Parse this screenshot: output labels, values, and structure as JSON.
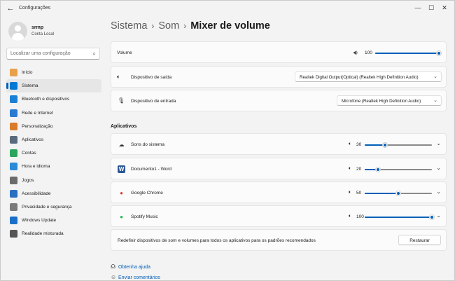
{
  "titlebar": {
    "back": "←",
    "title": "Configurações",
    "minimize": "—",
    "maximize": "☐",
    "close": "✕"
  },
  "profile": {
    "name": "srmp",
    "subtitle": "Conta Local"
  },
  "search": {
    "placeholder": "Localizar uma configuração",
    "icon": "⌕"
  },
  "nav": [
    {
      "label": "Início",
      "icon": "home-icon",
      "color": "#e8a04b"
    },
    {
      "label": "Sistema",
      "icon": "system-icon",
      "color": "#0078d4",
      "active": true
    },
    {
      "label": "Bluetooth e dispositivos",
      "icon": "bluetooth-icon",
      "color": "#1b7fd6"
    },
    {
      "label": "Rede e Internet",
      "icon": "network-icon",
      "color": "#2a7ad2"
    },
    {
      "label": "Personalização",
      "icon": "brush-icon",
      "color": "#d97b2b"
    },
    {
      "label": "Aplicativos",
      "icon": "apps-icon",
      "color": "#5a6b7d"
    },
    {
      "label": "Contas",
      "icon": "accounts-icon",
      "color": "#2ba55b"
    },
    {
      "label": "Hora e idioma",
      "icon": "time-language-icon",
      "color": "#2a8ad8"
    },
    {
      "label": "Jogos",
      "icon": "gaming-icon",
      "color": "#6b6b6b"
    },
    {
      "label": "Acessibilidade",
      "icon": "accessibility-icon",
      "color": "#2a6fc2"
    },
    {
      "label": "Privacidade e segurança",
      "icon": "shield-icon",
      "color": "#7a7a7a"
    },
    {
      "label": "Windows Update",
      "icon": "windows-update-icon",
      "color": "#1b6fc8"
    },
    {
      "label": "Realidade misturada",
      "icon": "mixed-reality-icon",
      "color": "#555555"
    }
  ],
  "breadcrumb": {
    "items": [
      "Sistema",
      "Som"
    ],
    "separator": "›",
    "current": "Mixer de volume"
  },
  "master": {
    "label": "Volume",
    "value": "100",
    "level": 1.0
  },
  "output": {
    "label": "Dispositivo de saída",
    "selected": "Realtek Digital Output(Optical) (Realtek High Definition Audio)"
  },
  "input": {
    "label": "Dispositivo de entrada",
    "selected": "Microfone (Realtek High Definition Audio)"
  },
  "apps_section": {
    "title": "Aplicativos"
  },
  "apps": [
    {
      "name": "Sons do sistema",
      "icon": "system-sounds-icon",
      "value": "30",
      "level": 0.3
    },
    {
      "name": "Documento1 - Word",
      "icon": "word-icon",
      "value": "20",
      "level": 0.2
    },
    {
      "name": "Google Chrome",
      "icon": "chrome-icon",
      "value": "50",
      "level": 0.5
    },
    {
      "name": "Spotify Music",
      "icon": "spotify-icon",
      "value": "100",
      "level": 1.0
    }
  ],
  "reset": {
    "text": "Redefinir dispositivos de som e volumes para todos os aplicativos para os padrões recomendados",
    "button": "Restaurar"
  },
  "footer": {
    "help": "Obtenha ajuda",
    "feedback": "Enviar comentários"
  },
  "colors": {
    "accent": "#005fb8"
  }
}
